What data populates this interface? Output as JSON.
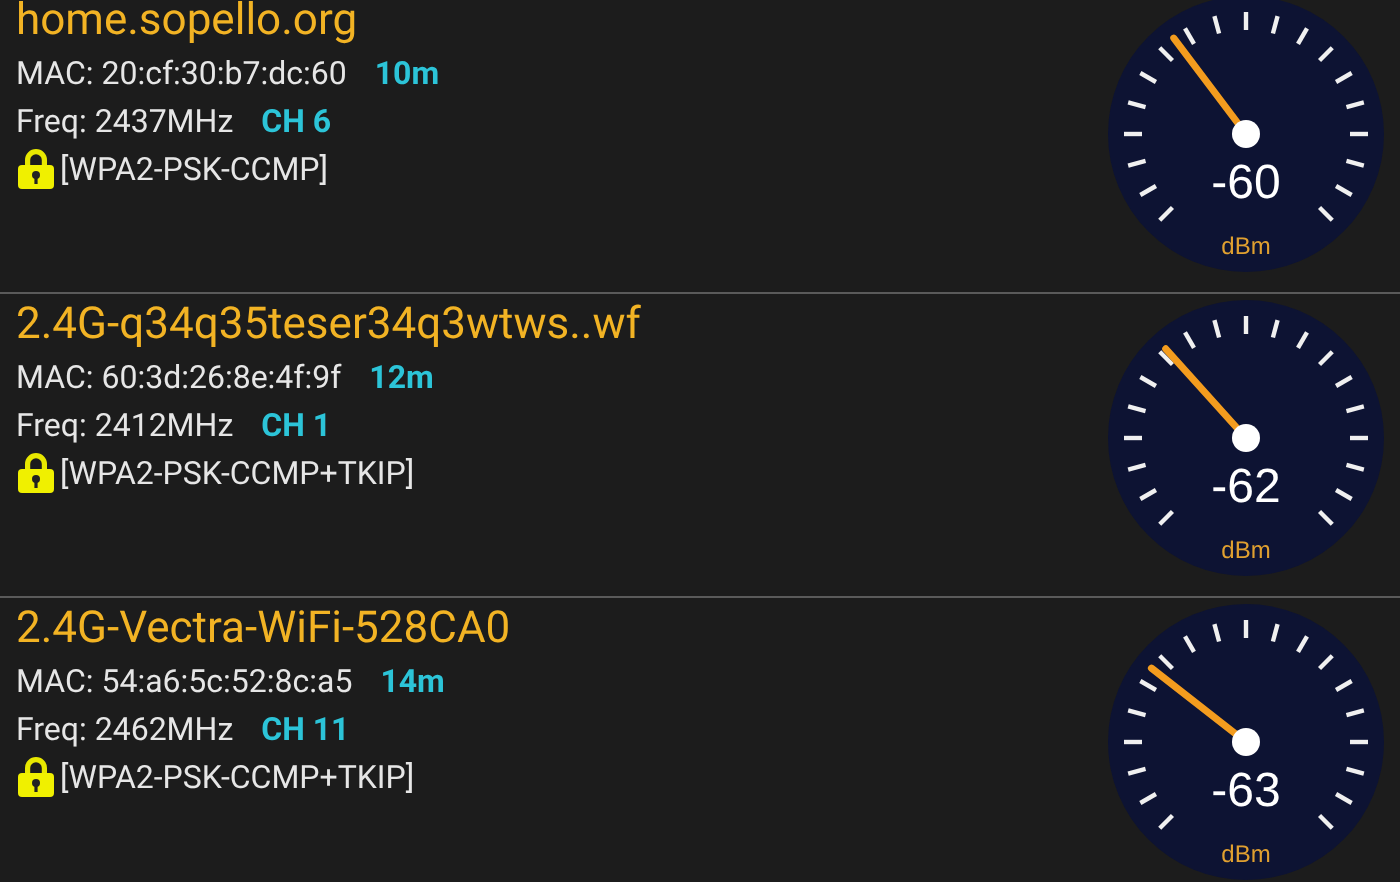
{
  "networks": [
    {
      "ssid": "home.sopello.org",
      "mac": "MAC: 20:cf:30:b7:dc:60",
      "distance": "10m",
      "freq": "Freq: 2437MHz",
      "channel": "CH 6",
      "security": "[WPA2-PSK-CCMP]",
      "signal": {
        "reading": "-60",
        "unit": "dBm"
      }
    },
    {
      "ssid": "2.4G-q34q35teser34q3wtws..wf",
      "mac": "MAC: 60:3d:26:8e:4f:9f",
      "distance": "12m",
      "freq": "Freq: 2412MHz",
      "channel": "CH 1",
      "security": "[WPA2-PSK-CCMP+TKIP]",
      "signal": {
        "reading": "-62",
        "unit": "dBm"
      }
    },
    {
      "ssid": "2.4G-Vectra-WiFi-528CA0",
      "mac": "MAC: 54:a6:5c:52:8c:a5",
      "distance": "14m",
      "freq": "Freq: 2462MHz",
      "channel": "CH 11",
      "security": "[WPA2-PSK-CCMP+TKIP]",
      "signal": {
        "reading": "-63",
        "unit": "dBm"
      }
    }
  ]
}
